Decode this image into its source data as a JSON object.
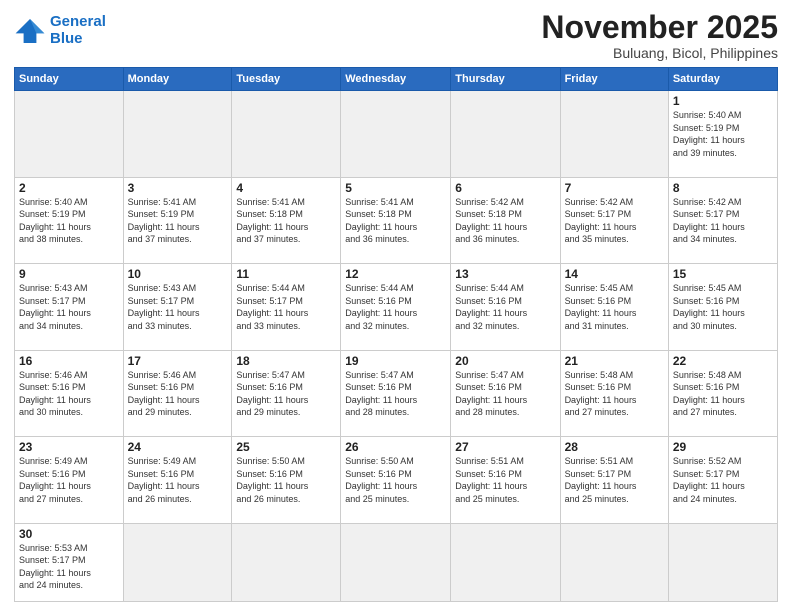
{
  "header": {
    "logo_general": "General",
    "logo_blue": "Blue",
    "month_title": "November 2025",
    "location": "Buluang, Bicol, Philippines"
  },
  "days_of_week": [
    "Sunday",
    "Monday",
    "Tuesday",
    "Wednesday",
    "Thursday",
    "Friday",
    "Saturday"
  ],
  "weeks": [
    [
      {
        "day": "",
        "detail": "",
        "empty": true
      },
      {
        "day": "",
        "detail": "",
        "empty": true
      },
      {
        "day": "",
        "detail": "",
        "empty": true
      },
      {
        "day": "",
        "detail": "",
        "empty": true
      },
      {
        "day": "",
        "detail": "",
        "empty": true
      },
      {
        "day": "",
        "detail": "",
        "empty": true
      },
      {
        "day": "1",
        "detail": "Sunrise: 5:40 AM\nSunset: 5:19 PM\nDaylight: 11 hours\nand 39 minutes."
      }
    ],
    [
      {
        "day": "2",
        "detail": "Sunrise: 5:40 AM\nSunset: 5:19 PM\nDaylight: 11 hours\nand 38 minutes."
      },
      {
        "day": "3",
        "detail": "Sunrise: 5:41 AM\nSunset: 5:19 PM\nDaylight: 11 hours\nand 37 minutes."
      },
      {
        "day": "4",
        "detail": "Sunrise: 5:41 AM\nSunset: 5:18 PM\nDaylight: 11 hours\nand 37 minutes."
      },
      {
        "day": "5",
        "detail": "Sunrise: 5:41 AM\nSunset: 5:18 PM\nDaylight: 11 hours\nand 36 minutes."
      },
      {
        "day": "6",
        "detail": "Sunrise: 5:42 AM\nSunset: 5:18 PM\nDaylight: 11 hours\nand 36 minutes."
      },
      {
        "day": "7",
        "detail": "Sunrise: 5:42 AM\nSunset: 5:17 PM\nDaylight: 11 hours\nand 35 minutes."
      },
      {
        "day": "8",
        "detail": "Sunrise: 5:42 AM\nSunset: 5:17 PM\nDaylight: 11 hours\nand 34 minutes."
      }
    ],
    [
      {
        "day": "9",
        "detail": "Sunrise: 5:43 AM\nSunset: 5:17 PM\nDaylight: 11 hours\nand 34 minutes."
      },
      {
        "day": "10",
        "detail": "Sunrise: 5:43 AM\nSunset: 5:17 PM\nDaylight: 11 hours\nand 33 minutes."
      },
      {
        "day": "11",
        "detail": "Sunrise: 5:44 AM\nSunset: 5:17 PM\nDaylight: 11 hours\nand 33 minutes."
      },
      {
        "day": "12",
        "detail": "Sunrise: 5:44 AM\nSunset: 5:16 PM\nDaylight: 11 hours\nand 32 minutes."
      },
      {
        "day": "13",
        "detail": "Sunrise: 5:44 AM\nSunset: 5:16 PM\nDaylight: 11 hours\nand 32 minutes."
      },
      {
        "day": "14",
        "detail": "Sunrise: 5:45 AM\nSunset: 5:16 PM\nDaylight: 11 hours\nand 31 minutes."
      },
      {
        "day": "15",
        "detail": "Sunrise: 5:45 AM\nSunset: 5:16 PM\nDaylight: 11 hours\nand 30 minutes."
      }
    ],
    [
      {
        "day": "16",
        "detail": "Sunrise: 5:46 AM\nSunset: 5:16 PM\nDaylight: 11 hours\nand 30 minutes."
      },
      {
        "day": "17",
        "detail": "Sunrise: 5:46 AM\nSunset: 5:16 PM\nDaylight: 11 hours\nand 29 minutes."
      },
      {
        "day": "18",
        "detail": "Sunrise: 5:47 AM\nSunset: 5:16 PM\nDaylight: 11 hours\nand 29 minutes."
      },
      {
        "day": "19",
        "detail": "Sunrise: 5:47 AM\nSunset: 5:16 PM\nDaylight: 11 hours\nand 28 minutes."
      },
      {
        "day": "20",
        "detail": "Sunrise: 5:47 AM\nSunset: 5:16 PM\nDaylight: 11 hours\nand 28 minutes."
      },
      {
        "day": "21",
        "detail": "Sunrise: 5:48 AM\nSunset: 5:16 PM\nDaylight: 11 hours\nand 27 minutes."
      },
      {
        "day": "22",
        "detail": "Sunrise: 5:48 AM\nSunset: 5:16 PM\nDaylight: 11 hours\nand 27 minutes."
      }
    ],
    [
      {
        "day": "23",
        "detail": "Sunrise: 5:49 AM\nSunset: 5:16 PM\nDaylight: 11 hours\nand 27 minutes."
      },
      {
        "day": "24",
        "detail": "Sunrise: 5:49 AM\nSunset: 5:16 PM\nDaylight: 11 hours\nand 26 minutes."
      },
      {
        "day": "25",
        "detail": "Sunrise: 5:50 AM\nSunset: 5:16 PM\nDaylight: 11 hours\nand 26 minutes."
      },
      {
        "day": "26",
        "detail": "Sunrise: 5:50 AM\nSunset: 5:16 PM\nDaylight: 11 hours\nand 25 minutes."
      },
      {
        "day": "27",
        "detail": "Sunrise: 5:51 AM\nSunset: 5:16 PM\nDaylight: 11 hours\nand 25 minutes."
      },
      {
        "day": "28",
        "detail": "Sunrise: 5:51 AM\nSunset: 5:17 PM\nDaylight: 11 hours\nand 25 minutes."
      },
      {
        "day": "29",
        "detail": "Sunrise: 5:52 AM\nSunset: 5:17 PM\nDaylight: 11 hours\nand 24 minutes."
      }
    ],
    [
      {
        "day": "30",
        "detail": "Sunrise: 5:53 AM\nSunset: 5:17 PM\nDaylight: 11 hours\nand 24 minutes."
      },
      {
        "day": "",
        "detail": "",
        "empty": true
      },
      {
        "day": "",
        "detail": "",
        "empty": true
      },
      {
        "day": "",
        "detail": "",
        "empty": true
      },
      {
        "day": "",
        "detail": "",
        "empty": true
      },
      {
        "day": "",
        "detail": "",
        "empty": true
      },
      {
        "day": "",
        "detail": "",
        "empty": true
      }
    ]
  ]
}
